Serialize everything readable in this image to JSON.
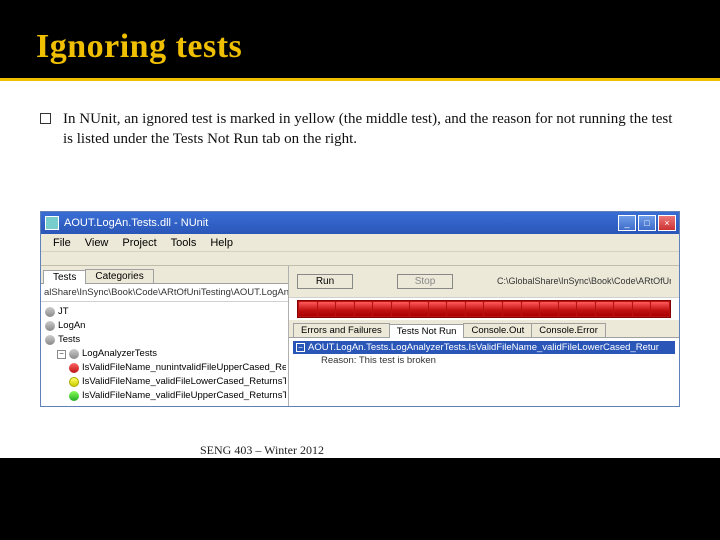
{
  "slide": {
    "title": "Ignoring tests",
    "bullet": "In NUnit, an ignored test is marked in yellow (the middle test), and the reason for not running the test is listed under the Tests Not Run tab on the right.",
    "footer": "SENG 403 – Winter 2012"
  },
  "window": {
    "title": "AOUT.LogAn.Tests.dll - NUnit",
    "menubar": [
      "File",
      "View",
      "Project",
      "Tools",
      "Help"
    ],
    "left": {
      "tabs": [
        "Tests",
        "Categories"
      ],
      "path": "alShare\\InSync\\Book\\Code\\ARtOfUniTesting\\AOUT.LogAn.",
      "tree": {
        "root": "JT",
        "n1": "LogAn",
        "n2": "Tests",
        "n3": "LogAnalyzerTests",
        "leaf1": "IsValidFileName_nunintvalidFileUpperCased_Re",
        "leaf2": "IsValidFileName_validFileLowerCased_ReturnsT",
        "leaf3": "IsValidFileName_validFileUpperCased_ReturnsT"
      }
    },
    "right": {
      "run": "Run",
      "stop": "Stop",
      "path": "C:\\GlobalShare\\InSync\\Book\\Code\\ARtOfUniTesting\\AOUT.LogAn.Tests\\bin\\Debug\\A",
      "tabs": [
        "Errors and Failures",
        "Tests Not Run",
        "Console.Out",
        "Console.Error"
      ],
      "selected": "AOUT.LogAn.Tests.LogAnalyzerTests.IsValidFileName_validFileLowerCased_Retur",
      "reason": "Reason: This test is broken"
    }
  }
}
